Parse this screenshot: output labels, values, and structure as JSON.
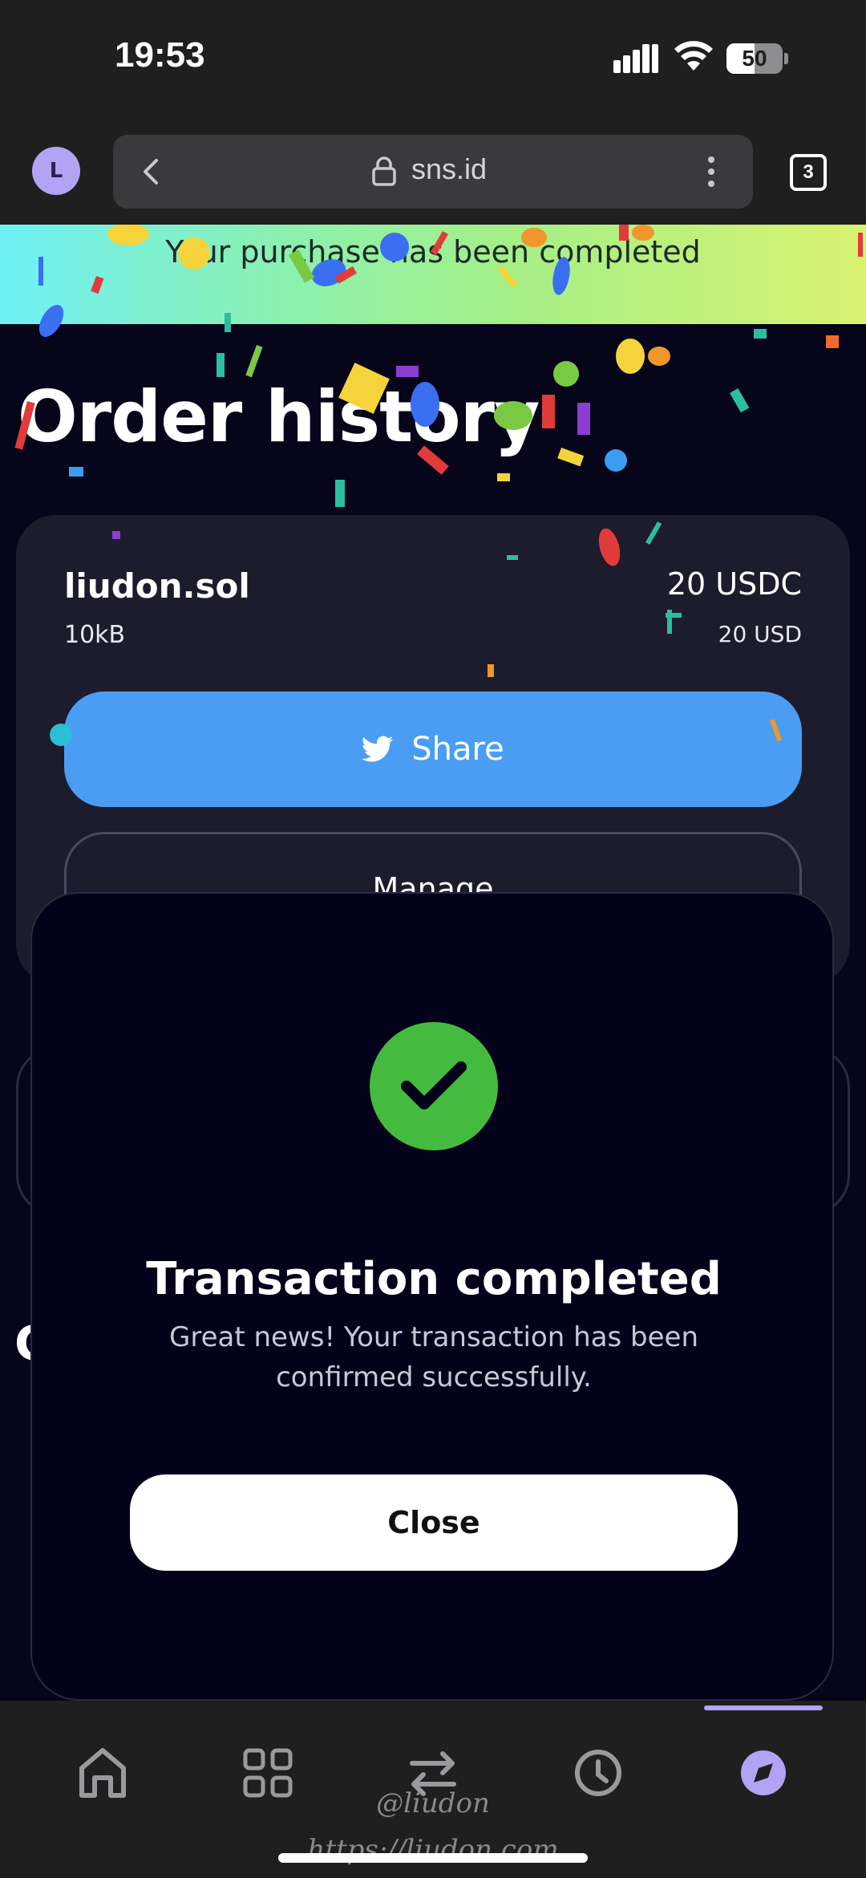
{
  "status_bar": {
    "time": "19:53",
    "battery": "50",
    "battery_level": 0.5
  },
  "browser": {
    "avatar_letter": "L",
    "url": "sns.id",
    "tab_count": "3"
  },
  "banner": {
    "text": "Your purchase has been completed"
  },
  "page": {
    "title": "Order history"
  },
  "order": {
    "domain": "liudon.sol",
    "size": "10kB",
    "price_token": "20 USDC",
    "price_fiat": "20 USD",
    "share_label": "Share",
    "manage_label": "Manage"
  },
  "modal": {
    "title": "Transaction completed",
    "message": "Great news! Your transaction has been confirmed successfully.",
    "close_label": "Close"
  },
  "nav": {
    "items": [
      "home-icon",
      "apps-icon",
      "swap-icon",
      "history-icon",
      "explore-icon"
    ],
    "active": "explore"
  },
  "watermark": {
    "handle": "@liudon",
    "url": "https://liudon.com"
  },
  "colors": {
    "accent": "#b3a3f4",
    "share_blue": "#4a9df2",
    "success_green": "#44bb3e",
    "background": "#06051a"
  }
}
